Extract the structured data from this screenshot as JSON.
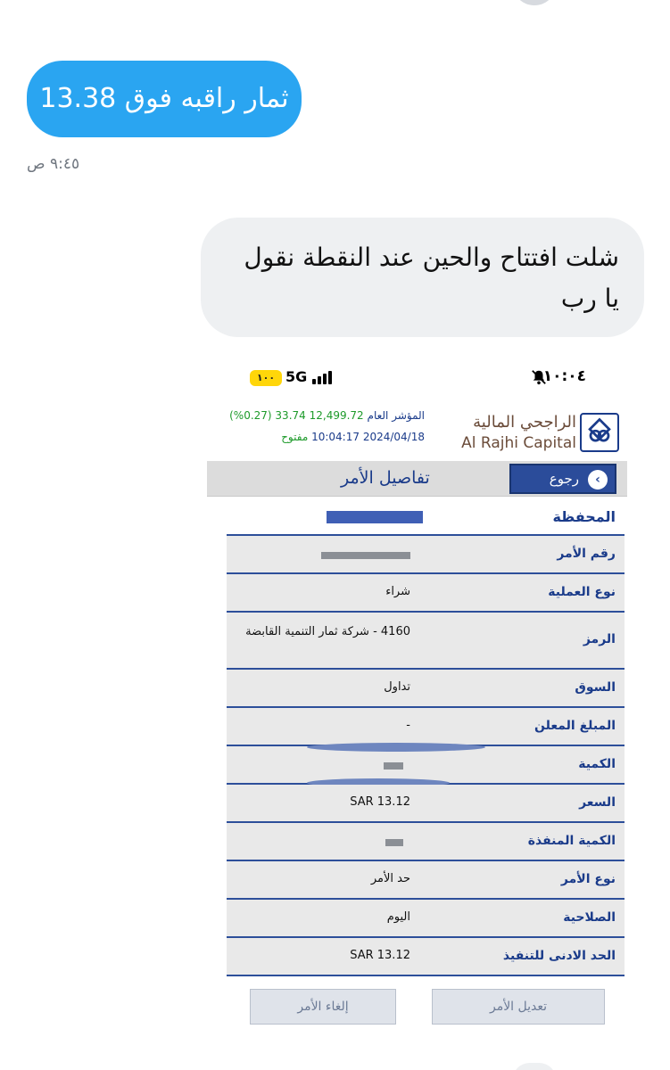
{
  "chat": {
    "outgoing_text": "ثمار راقبه فوق 13.38",
    "outgoing_time": "٩:٤٥ ص",
    "incoming_text": "شلت افتتاح والحين عند النقطة نقول يا رب"
  },
  "embedded": {
    "status": {
      "battery": "١٠٠",
      "network": "5G",
      "time": "١٠:٠٤"
    },
    "market": {
      "index_label": "المؤشر العام",
      "index_value": "12,499.72",
      "change": "33.74",
      "change_pct": "(0.27%)",
      "datetime": "2024/04/18 10:04:17",
      "state": "مفتوح"
    },
    "brand": {
      "arabic": "الراجحي المالية",
      "english": "Al Rajhi Capital"
    },
    "back_label": "رجوع",
    "page_title": "تفاصيل الأمر",
    "rows": [
      {
        "label": "المحفظة",
        "value": ""
      },
      {
        "label": "رقم الأمر",
        "value": ""
      },
      {
        "label": "نوع العملية",
        "value": "شراء"
      },
      {
        "label": "الرمز",
        "value": "4160 - شركة ثمار التنمية القابضة"
      },
      {
        "label": "السوق",
        "value": "تداول"
      },
      {
        "label": "المبلغ المعلن",
        "value": "-"
      },
      {
        "label": "الكمية",
        "value": ""
      },
      {
        "label": "السعر",
        "value": "SAR 13.12"
      },
      {
        "label": "الكمية المنفذة",
        "value": ""
      },
      {
        "label": "نوع الأمر",
        "value": "حد الأمر"
      },
      {
        "label": "الصلاحية",
        "value": "اليوم"
      },
      {
        "label": "الحد الادنى للتنفيذ",
        "value": "SAR 13.12"
      }
    ],
    "buttons": {
      "edit": "تعديل الأمر",
      "cancel": "إلغاء الأمر"
    }
  }
}
